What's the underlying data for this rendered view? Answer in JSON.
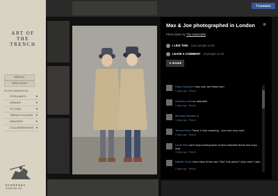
{
  "sidebar": {
    "brand": [
      "ART OF",
      "THE",
      "TRENCH"
    ],
    "buttons": [
      "NEW ALL",
      "VIEW LATEST"
    ],
    "filters_title": "FILTER IMAGES BY:",
    "filters": [
      "POPULARITY",
      "GENDER",
      "STYLING",
      "TRENCH COLOUR",
      "WEATHER",
      "COLLABORATIONS"
    ],
    "crest_text": "BURBERRY",
    "crest_sub": "ESTABLISHED 1856"
  },
  "header": {
    "facebook_label": "Connect"
  },
  "panel": {
    "title": "Max & Joe photographed in London",
    "taken_prefix": "Photo taken by",
    "taken_by": "The Sartorialist",
    "like_label": "I LIKE THIS",
    "like_count": "1144 people so far",
    "comment_label": "LEAVE A COMMENT",
    "comment_count": "22 people so far",
    "share_label": "SHARE",
    "comments": [
      {
        "user": "Ruby Johnston",
        "text": "How cute are these two!",
        "meta": "3 days ago · Report"
      },
      {
        "user": "anthony chan",
        "text": "so adorable",
        "meta": "3 days ago · Report"
      },
      {
        "user": "Miroslav Bazilian",
        "text": ":)",
        "meta": "3 days ago · Report"
      },
      {
        "user": "Teresa Rose",
        "text": "These 2 look amazing - cool and very cute!",
        "meta": "3 days ago · Report"
      },
      {
        "user": "Linda Sitt",
        "text": "I can't stop looking back at how adorable these two boys look.",
        "meta": "3 days ago · Report"
      },
      {
        "user": "Natalie Parks",
        "text": "how many times can I 'like' this photo? only once? darn.",
        "meta": "3 days ago · Report"
      }
    ]
  },
  "colors": {
    "sidebar_bg": "#d9d3c4",
    "panel_bg": "#000000",
    "link": "#6a93d8",
    "facebook": "#3b5998"
  }
}
